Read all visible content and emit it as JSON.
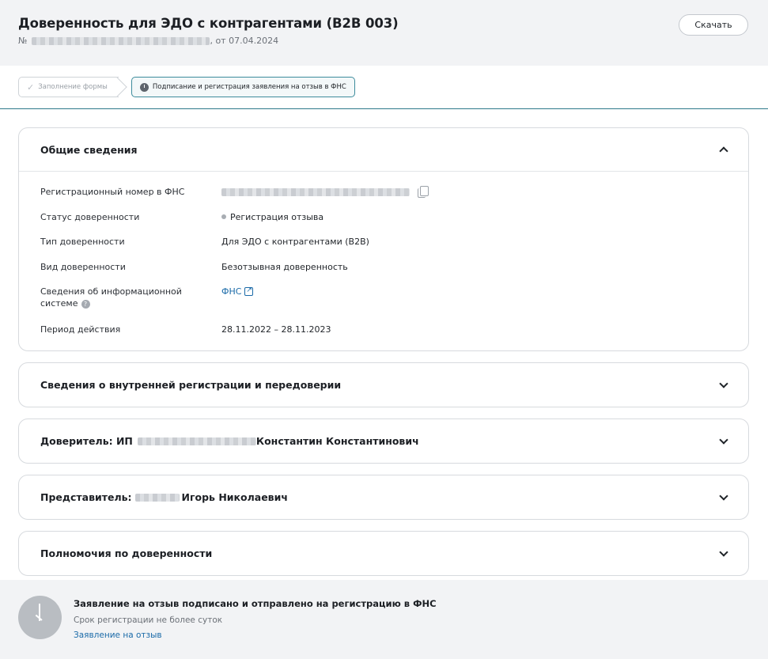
{
  "header": {
    "title": "Доверенность для ЭДО с контрагентами (B2B 003)",
    "number_prefix": "№",
    "date_text": ", от 07.04.2024",
    "download_label": "Скачать"
  },
  "steps": [
    {
      "label": "Заполнение формы",
      "state": "done"
    },
    {
      "label": "Подписание и регистрация заявления на отзыв в ФНС",
      "state": "active"
    }
  ],
  "general": {
    "title": "Общие сведения",
    "rows": {
      "reg_number_label": "Регистрационный номер в ФНС",
      "status_label": "Статус доверенности",
      "status_value": "Регистрация отзыва",
      "type_label": "Тип доверенности",
      "type_value": "Для ЭДО с контрагентами (B2B)",
      "kind_label": "Вид доверенности",
      "kind_value": "Безотзывная доверенность",
      "infosys_label": "Сведения об информационной системе",
      "infosys_value": "ФНС",
      "period_label": "Период действия",
      "period_value": "28.11.2022 – 28.11.2023"
    }
  },
  "sections": {
    "internal": "Сведения о внутренней регистрации и передоверии",
    "principal_prefix": "Доверитель: ИП",
    "principal_name": "Константин Константинович",
    "representative_prefix": "Представитель:",
    "representative_name": "Игорь Николаевич",
    "powers": "Полномочия по доверенности"
  },
  "footer": {
    "title": "Заявление на отзыв подписано и отправлено на регистрацию в ФНС",
    "subtitle": "Срок регистрации не более суток",
    "link": "Заявление на отзыв"
  }
}
